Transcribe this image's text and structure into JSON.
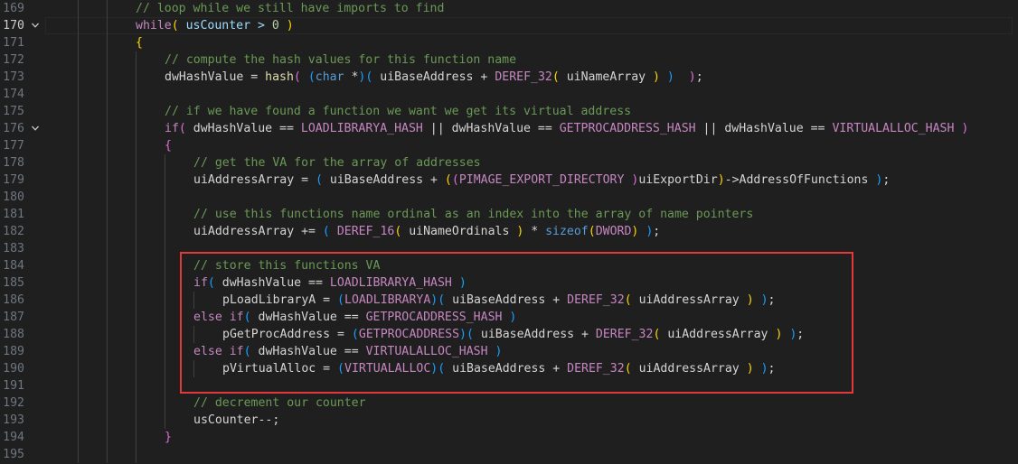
{
  "editor": {
    "current_line": 170,
    "folded_lines": [
      170,
      176
    ],
    "highlight": {
      "color": "#e5383b"
    },
    "lines": [
      {
        "number": "169",
        "indent": 3,
        "tokens": [
          {
            "t": "// loop while we still have imports to find",
            "c": "comment"
          }
        ]
      },
      {
        "number": "170",
        "indent": 3,
        "tokens": [
          {
            "t": "while",
            "c": "keyword"
          },
          {
            "t": "(",
            "c": "brace"
          },
          {
            "t": " usCounter > ",
            "c": "text"
          },
          {
            "t": "0",
            "c": "num"
          },
          {
            "t": " ",
            "c": "text"
          },
          {
            "t": ")",
            "c": "brace"
          }
        ]
      },
      {
        "number": "171",
        "indent": 3,
        "tokens": [
          {
            "t": "{",
            "c": "brace"
          }
        ]
      },
      {
        "number": "172",
        "indent": 4,
        "tokens": [
          {
            "t": "// compute the hash values for this function name",
            "c": "comment"
          }
        ]
      },
      {
        "number": "173",
        "indent": 4,
        "tokens": [
          {
            "t": "dwHashValue = ",
            "c": "plain"
          },
          {
            "t": "hash",
            "c": "func"
          },
          {
            "t": "( ",
            "c": "paren2"
          },
          {
            "t": "(",
            "c": "paren3"
          },
          {
            "t": "char",
            "c": "type"
          },
          {
            "t": " *",
            "c": "op"
          },
          {
            "t": ")",
            "c": "paren3"
          },
          {
            "t": "( ",
            "c": "paren3"
          },
          {
            "t": "uiBaseAddress + ",
            "c": "plain"
          },
          {
            "t": "DEREF_32",
            "c": "macro"
          },
          {
            "t": "( ",
            "c": "brace"
          },
          {
            "t": "uiNameArray ",
            "c": "plain"
          },
          {
            "t": ")",
            "c": "brace"
          },
          {
            "t": " ",
            "c": "plain"
          },
          {
            "t": ")",
            "c": "paren3"
          },
          {
            "t": "  ",
            "c": "plain"
          },
          {
            "t": ")",
            "c": "paren2"
          },
          {
            "t": ";",
            "c": "plain"
          }
        ]
      },
      {
        "number": "174",
        "indent": 4,
        "tokens": []
      },
      {
        "number": "175",
        "indent": 4,
        "tokens": [
          {
            "t": "// if we have found a function we want we get its virtual address",
            "c": "comment"
          }
        ]
      },
      {
        "number": "176",
        "indent": 4,
        "tokens": [
          {
            "t": "if",
            "c": "keyword"
          },
          {
            "t": "( ",
            "c": "paren2"
          },
          {
            "t": "dwHashValue == ",
            "c": "plain"
          },
          {
            "t": "LOADLIBRARYA_HASH",
            "c": "macro"
          },
          {
            "t": " || dwHashValue == ",
            "c": "plain"
          },
          {
            "t": "GETPROCADDRESS_HASH",
            "c": "macro"
          },
          {
            "t": " || dwHashValue == ",
            "c": "plain"
          },
          {
            "t": "VIRTUALALLOC_HASH",
            "c": "macro"
          },
          {
            "t": " ",
            "c": "plain"
          },
          {
            "t": ")",
            "c": "paren2"
          }
        ]
      },
      {
        "number": "177",
        "indent": 4,
        "tokens": [
          {
            "t": "{",
            "c": "paren2"
          }
        ]
      },
      {
        "number": "178",
        "indent": 5,
        "tokens": [
          {
            "t": "// get the VA for the array of addresses",
            "c": "comment"
          }
        ]
      },
      {
        "number": "179",
        "indent": 5,
        "tokens": [
          {
            "t": "uiAddressArray = ",
            "c": "plain"
          },
          {
            "t": "( ",
            "c": "paren3"
          },
          {
            "t": "uiBaseAddress + ",
            "c": "plain"
          },
          {
            "t": "(",
            "c": "brace"
          },
          {
            "t": "(",
            "c": "paren2"
          },
          {
            "t": "PIMAGE_EXPORT_DIRECTORY ",
            "c": "macro"
          },
          {
            "t": ")",
            "c": "paren2"
          },
          {
            "t": "uiExportDir",
            "c": "plain"
          },
          {
            "t": ")",
            "c": "brace"
          },
          {
            "t": "->AddressOfFunctions ",
            "c": "plain"
          },
          {
            "t": ")",
            "c": "paren3"
          },
          {
            "t": ";",
            "c": "plain"
          }
        ]
      },
      {
        "number": "180",
        "indent": 5,
        "tokens": []
      },
      {
        "number": "181",
        "indent": 5,
        "tokens": [
          {
            "t": "// use this functions name ordinal as an index into the array of name pointers",
            "c": "comment"
          }
        ]
      },
      {
        "number": "182",
        "indent": 5,
        "tokens": [
          {
            "t": "uiAddressArray += ",
            "c": "plain"
          },
          {
            "t": "( ",
            "c": "paren3"
          },
          {
            "t": "DEREF_16",
            "c": "macro"
          },
          {
            "t": "( ",
            "c": "brace"
          },
          {
            "t": "uiNameOrdinals ",
            "c": "plain"
          },
          {
            "t": ")",
            "c": "brace"
          },
          {
            "t": " * ",
            "c": "plain"
          },
          {
            "t": "sizeof",
            "c": "type"
          },
          {
            "t": "(",
            "c": "brace"
          },
          {
            "t": "DWORD",
            "c": "macro"
          },
          {
            "t": ")",
            "c": "brace"
          },
          {
            "t": " ",
            "c": "plain"
          },
          {
            "t": ")",
            "c": "paren3"
          },
          {
            "t": ";",
            "c": "plain"
          }
        ]
      },
      {
        "number": "183",
        "indent": 5,
        "tokens": []
      },
      {
        "number": "184",
        "indent": 5,
        "tokens": [
          {
            "t": "// store this functions VA",
            "c": "comment"
          }
        ]
      },
      {
        "number": "185",
        "indent": 5,
        "tokens": [
          {
            "t": "if",
            "c": "keyword"
          },
          {
            "t": "( ",
            "c": "paren3"
          },
          {
            "t": "dwHashValue == ",
            "c": "plain"
          },
          {
            "t": "LOADLIBRARYA_HASH",
            "c": "macro"
          },
          {
            "t": " ",
            "c": "plain"
          },
          {
            "t": ")",
            "c": "paren3"
          }
        ]
      },
      {
        "number": "186",
        "indent": 6,
        "tokens": [
          {
            "t": "pLoadLibraryA = ",
            "c": "plain"
          },
          {
            "t": "(",
            "c": "paren3"
          },
          {
            "t": "LOADLIBRARYA",
            "c": "macro"
          },
          {
            "t": ")",
            "c": "paren3"
          },
          {
            "t": "( ",
            "c": "paren3"
          },
          {
            "t": "uiBaseAddress + ",
            "c": "plain"
          },
          {
            "t": "DEREF_32",
            "c": "macro"
          },
          {
            "t": "( ",
            "c": "brace"
          },
          {
            "t": "uiAddressArray ",
            "c": "plain"
          },
          {
            "t": ")",
            "c": "brace"
          },
          {
            "t": " ",
            "c": "plain"
          },
          {
            "t": ")",
            "c": "paren3"
          },
          {
            "t": ";",
            "c": "plain"
          }
        ]
      },
      {
        "number": "187",
        "indent": 5,
        "tokens": [
          {
            "t": "else",
            "c": "keyword"
          },
          {
            "t": " ",
            "c": "plain"
          },
          {
            "t": "if",
            "c": "keyword"
          },
          {
            "t": "( ",
            "c": "paren3"
          },
          {
            "t": "dwHashValue == ",
            "c": "plain"
          },
          {
            "t": "GETPROCADDRESS_HASH",
            "c": "macro"
          },
          {
            "t": " ",
            "c": "plain"
          },
          {
            "t": ")",
            "c": "paren3"
          }
        ]
      },
      {
        "number": "188",
        "indent": 6,
        "tokens": [
          {
            "t": "pGetProcAddress = ",
            "c": "plain"
          },
          {
            "t": "(",
            "c": "paren3"
          },
          {
            "t": "GETPROCADDRESS",
            "c": "macro"
          },
          {
            "t": ")",
            "c": "paren3"
          },
          {
            "t": "( ",
            "c": "paren3"
          },
          {
            "t": "uiBaseAddress + ",
            "c": "plain"
          },
          {
            "t": "DEREF_32",
            "c": "macro"
          },
          {
            "t": "( ",
            "c": "brace"
          },
          {
            "t": "uiAddressArray ",
            "c": "plain"
          },
          {
            "t": ")",
            "c": "brace"
          },
          {
            "t": " ",
            "c": "plain"
          },
          {
            "t": ")",
            "c": "paren3"
          },
          {
            "t": ";",
            "c": "plain"
          }
        ]
      },
      {
        "number": "189",
        "indent": 5,
        "tokens": [
          {
            "t": "else",
            "c": "keyword"
          },
          {
            "t": " ",
            "c": "plain"
          },
          {
            "t": "if",
            "c": "keyword"
          },
          {
            "t": "( ",
            "c": "paren3"
          },
          {
            "t": "dwHashValue == ",
            "c": "plain"
          },
          {
            "t": "VIRTUALALLOC_HASH",
            "c": "macro"
          },
          {
            "t": " ",
            "c": "plain"
          },
          {
            "t": ")",
            "c": "paren3"
          }
        ]
      },
      {
        "number": "190",
        "indent": 6,
        "tokens": [
          {
            "t": "pVirtualAlloc = ",
            "c": "plain"
          },
          {
            "t": "(",
            "c": "paren3"
          },
          {
            "t": "VIRTUALALLOC",
            "c": "macro"
          },
          {
            "t": ")",
            "c": "paren3"
          },
          {
            "t": "( ",
            "c": "paren3"
          },
          {
            "t": "uiBaseAddress + ",
            "c": "plain"
          },
          {
            "t": "DEREF_32",
            "c": "macro"
          },
          {
            "t": "( ",
            "c": "brace"
          },
          {
            "t": "uiAddressArray ",
            "c": "plain"
          },
          {
            "t": ")",
            "c": "brace"
          },
          {
            "t": " ",
            "c": "plain"
          },
          {
            "t": ")",
            "c": "paren3"
          },
          {
            "t": ";",
            "c": "plain"
          }
        ]
      },
      {
        "number": "191",
        "indent": 5,
        "tokens": []
      },
      {
        "number": "192",
        "indent": 5,
        "tokens": [
          {
            "t": "// decrement our counter",
            "c": "comment"
          }
        ]
      },
      {
        "number": "193",
        "indent": 5,
        "tokens": [
          {
            "t": "usCounter--;",
            "c": "plain"
          }
        ]
      },
      {
        "number": "194",
        "indent": 4,
        "tokens": [
          {
            "t": "}",
            "c": "paren2"
          }
        ]
      },
      {
        "number": "195",
        "indent": 4,
        "tokens": []
      }
    ]
  }
}
